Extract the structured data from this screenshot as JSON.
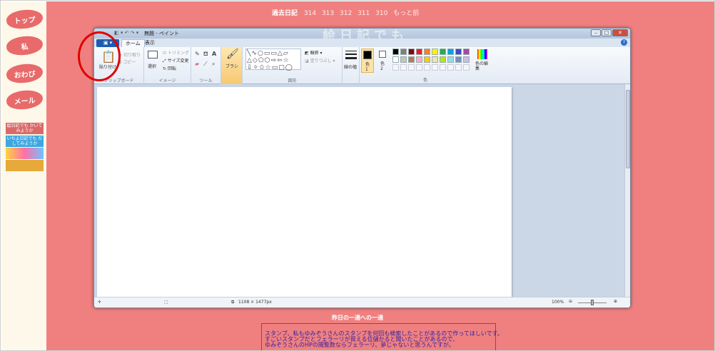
{
  "nav": {
    "top": "トップ",
    "me": "私",
    "apology": "おわび",
    "mail": "メール",
    "banners": [
      "絵日記でも かいてみようか",
      "いちよ日記でも だしてみようか",
      "",
      ""
    ]
  },
  "header": {
    "past_diary": "過去日記",
    "links": [
      "314",
      "313",
      "312",
      "311",
      "310",
      "もっと前"
    ]
  },
  "paint": {
    "title": "無題 - ペイント",
    "tabs": {
      "home": "ホーム",
      "view": "表示"
    },
    "clipboard": {
      "paste": "貼り付け",
      "cut": "切り取り",
      "copy": "コピー",
      "label": "クリップボード"
    },
    "image": {
      "select": "選択",
      "crop": "トリミング",
      "resize": "サイズ変更",
      "rotate": "回転",
      "label": "イメージ"
    },
    "tools": {
      "label": "ツール"
    },
    "brush": {
      "label": "ブラシ"
    },
    "shapes": {
      "outline": "輪郭",
      "fill": "塗りつぶし",
      "label": "図形"
    },
    "size": {
      "label": "線の幅"
    },
    "color": {
      "color1": "色\n1",
      "color2": "色\n2",
      "edit": "色の編集",
      "label": "色"
    },
    "palette_row1": [
      "#000000",
      "#7f7f7f",
      "#880015",
      "#ed1c24",
      "#ff7f27",
      "#fff200",
      "#22b14c",
      "#00a2e8",
      "#3f48cc",
      "#a349a4"
    ],
    "palette_row2": [
      "#ffffff",
      "#c3c3c3",
      "#b97a57",
      "#ffaec9",
      "#ffc90e",
      "#efe4b0",
      "#b5e61d",
      "#99d9ea",
      "#7092be",
      "#c8bfe7"
    ],
    "status": {
      "dimensions": "1108 × 1477px",
      "zoom": "100%"
    }
  },
  "page": {
    "caption": "昨日の一通への一通",
    "lines": [
      "スタンプ、私もゆみぞうさんのスタンプを何回も検索したことがあるので作ってほしいです。",
      "すごいスタンプだとフェラーリが買える位儲かると聞いたことがあるので、",
      "ゆみぞうさんのHPの閲覧数ならフェラーリ、夢じゃないと思うんですが。"
    ]
  }
}
